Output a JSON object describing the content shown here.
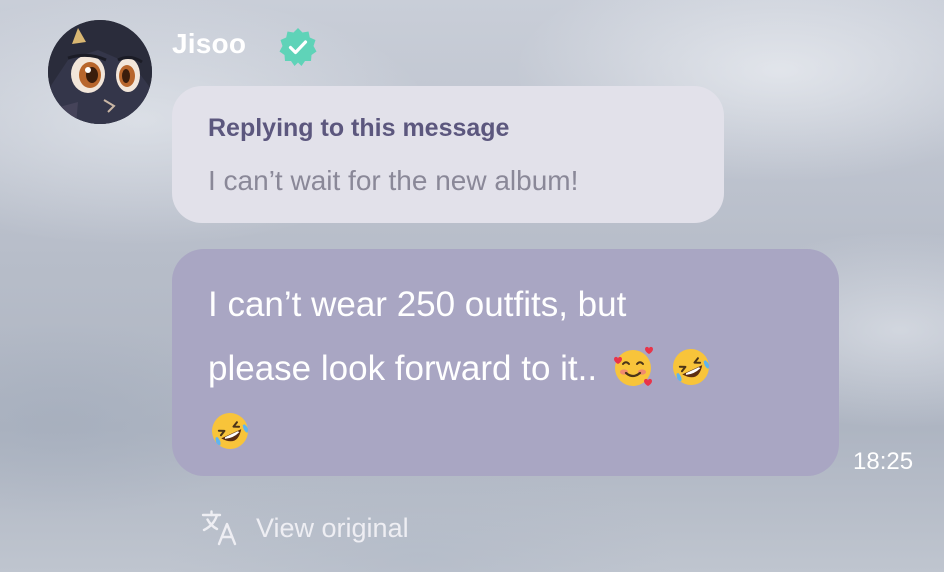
{
  "sender": {
    "name": "Jisoo",
    "verified": true,
    "verified_color": "#5fd3b8",
    "avatar_icon": "cat-avatar-icon"
  },
  "reply": {
    "title": "Replying to this message",
    "text": "I can’t wait for the new album!"
  },
  "message": {
    "line1": "I can’t wear 250 outfits, but",
    "line2": "please look forward to it..",
    "emojis": [
      "smiling-face-with-hearts-emoji",
      "rolling-on-floor-laughing-emoji",
      "rolling-on-floor-laughing-emoji"
    ],
    "timestamp": "18:25"
  },
  "actions": {
    "view_original": "View original",
    "translate_icon": "translate-icon"
  },
  "colors": {
    "reply_bubble": "#e2e1ea",
    "reply_title": "#5c577e",
    "message_bubble": "#a9a6c3"
  }
}
